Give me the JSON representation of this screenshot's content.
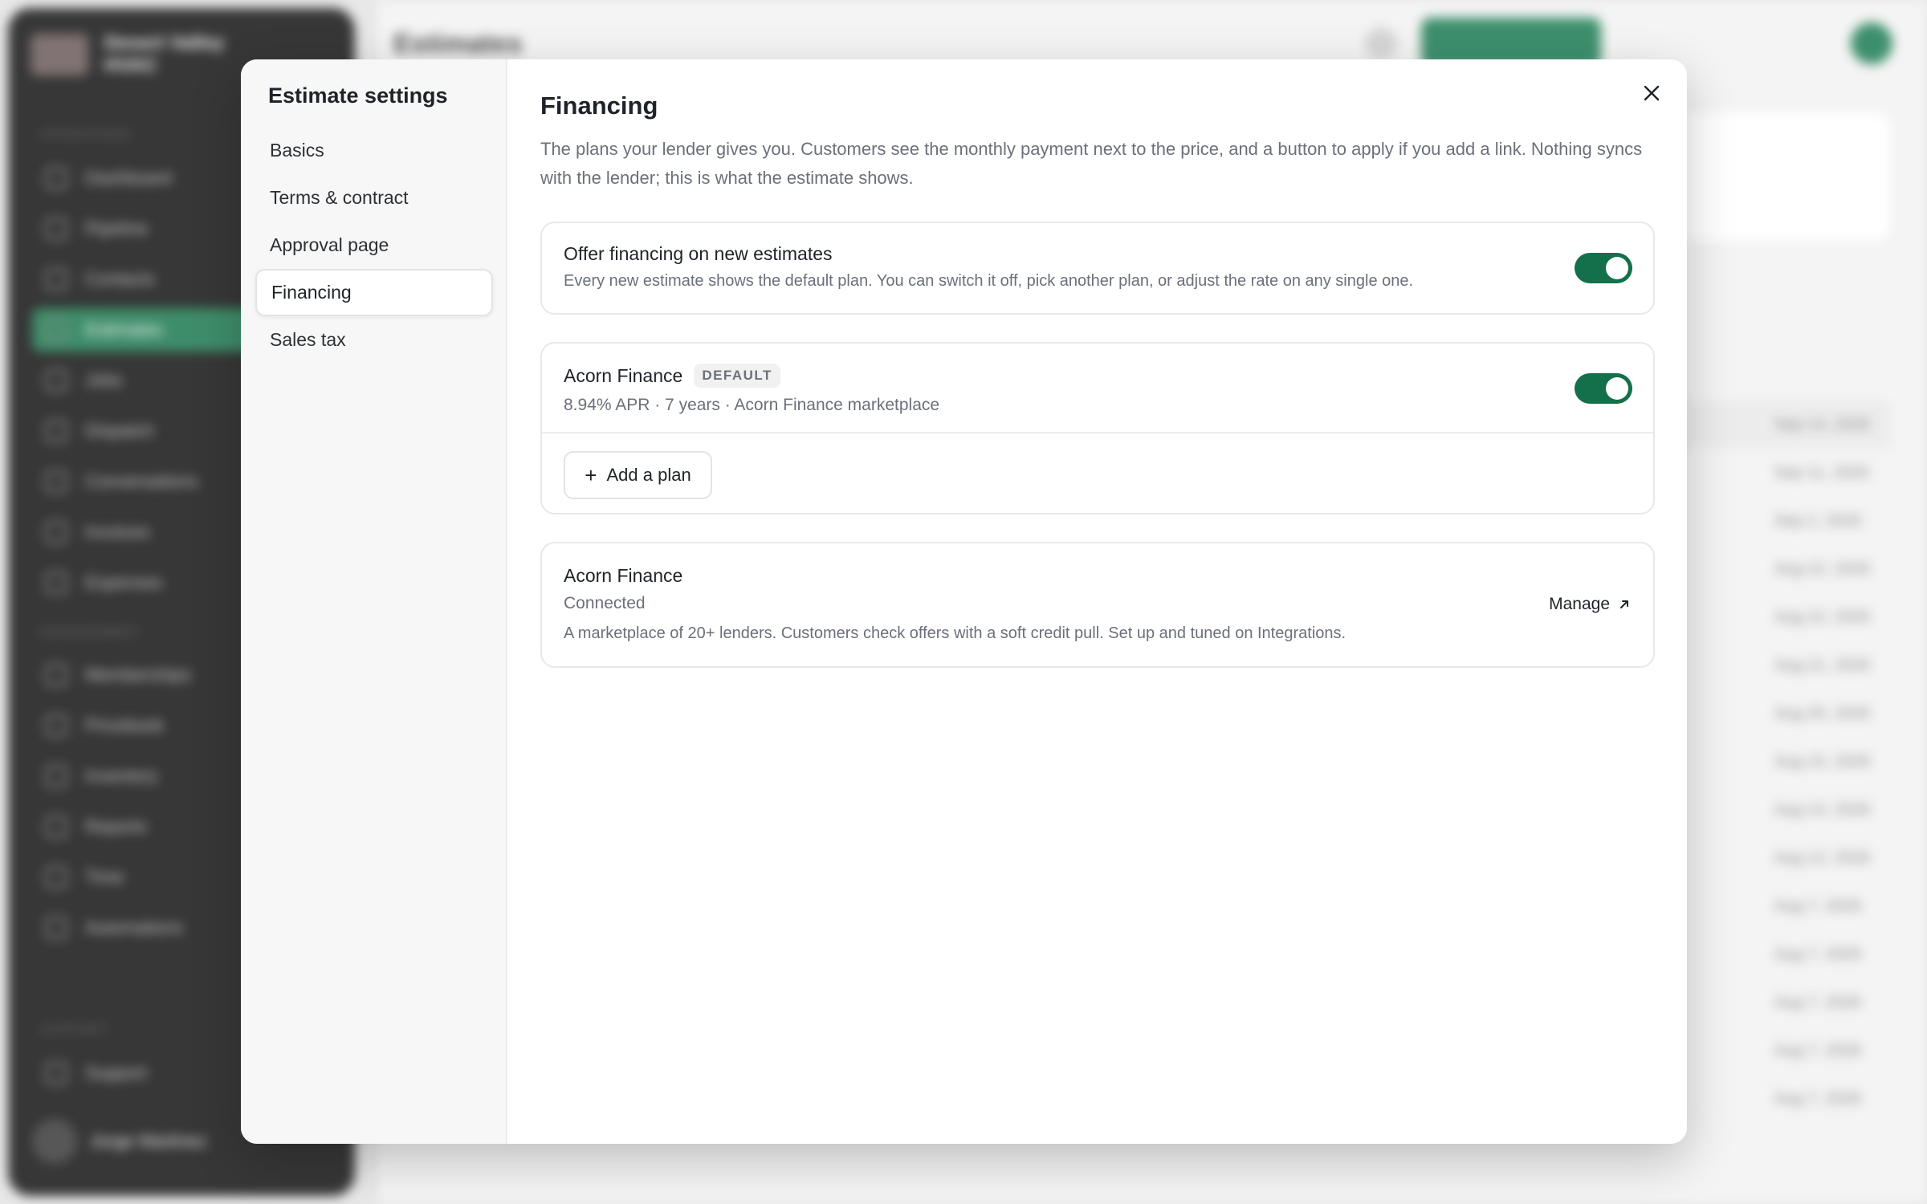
{
  "background": {
    "brand_name": "Desert Valley HVAC",
    "section_operations": "OPERATIONS",
    "section_management": "MANAGEMENT",
    "section_support": "SUPPORT",
    "nav": [
      "Dashboard",
      "Pipeline",
      "Contacts",
      "Estimates",
      "Jobs",
      "Dispatch",
      "Conversations",
      "Invoices",
      "Expenses"
    ],
    "nav2": [
      "Memberships",
      "Pricebook",
      "Inventory",
      "Reports",
      "Time",
      "Automations"
    ],
    "nav3": [
      "Support"
    ],
    "user_name": "Jorge Martinez",
    "page_title": "Estimates",
    "new_button": "New estimate",
    "dates": [
      "Sep 14, 2026",
      "Sep 11, 2026",
      "Sep 2, 2026",
      "Aug 22, 2026",
      "Aug 22, 2026",
      "Aug 21, 2026",
      "Aug 20, 2026",
      "Aug 15, 2026",
      "Aug 14, 2026",
      "Aug 12, 2026",
      "Aug 7, 2026",
      "Aug 7, 2026",
      "Aug 7, 2026",
      "Aug 7, 2026",
      "Aug 7, 2026"
    ]
  },
  "modal": {
    "title": "Estimate settings",
    "nav": [
      {
        "label": "Basics",
        "active": false
      },
      {
        "label": "Terms & contract",
        "active": false
      },
      {
        "label": "Approval page",
        "active": false
      },
      {
        "label": "Financing",
        "active": true
      },
      {
        "label": "Sales tax",
        "active": false
      }
    ],
    "close_label": "×"
  },
  "financing": {
    "title": "Financing",
    "description": "The plans your lender gives you. Customers see the monthly payment next to the price, and a button to apply if you add a link. Nothing syncs with the lender; this is what the estimate shows.",
    "offer": {
      "title": "Offer financing on new estimates",
      "subtitle": "Every new estimate shows the default plan. You can switch it off, pick another plan, or adjust the rate on any single one.",
      "enabled": true
    },
    "plan": {
      "name": "Acorn Finance",
      "badge": "DEFAULT",
      "detail": "8.94% APR · 7 years · Acorn Finance marketplace",
      "enabled": true
    },
    "add_plan_label": "Add a plan",
    "lender": {
      "name": "Acorn Finance",
      "status": "Connected",
      "description": "A marketplace of 20+ lenders. Customers check offers with a soft credit pull. Set up and tuned on Integrations.",
      "manage_label": "Manage"
    }
  },
  "colors": {
    "accent": "#14704a",
    "sidebar_bg": "#141414"
  }
}
